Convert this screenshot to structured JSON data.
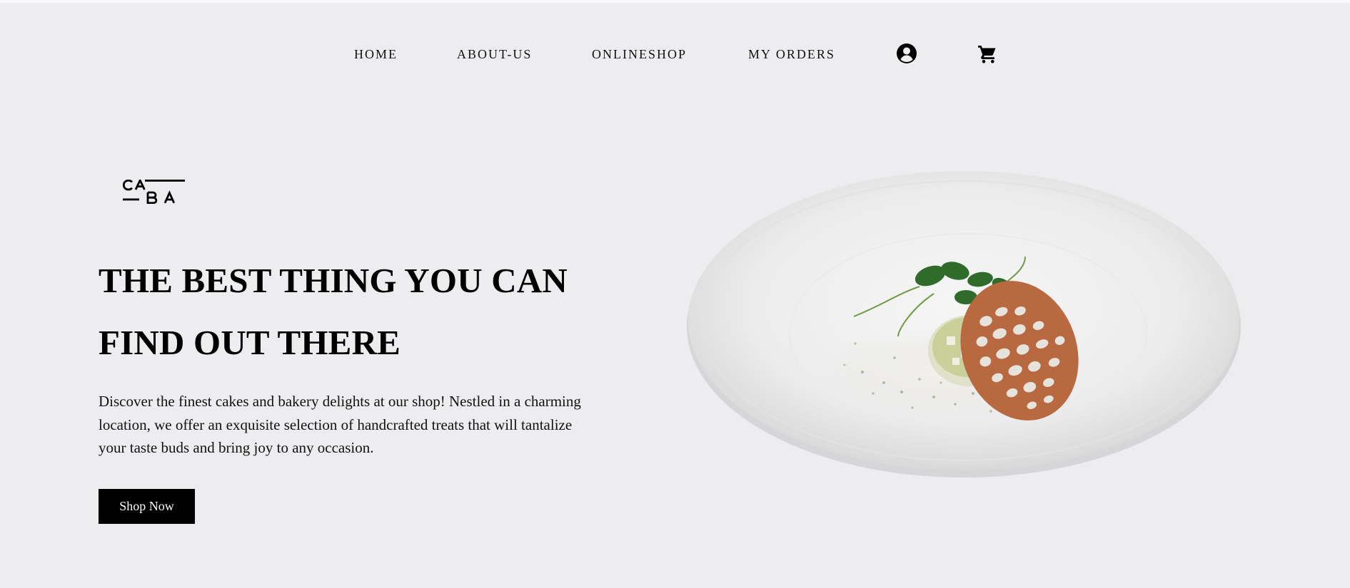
{
  "nav": {
    "items": [
      {
        "label": "HOME"
      },
      {
        "label": "ABOUT-US"
      },
      {
        "label": "ONLINESHOP"
      },
      {
        "label": "MY ORDERS"
      }
    ],
    "account_icon": "user-circle-icon",
    "cart_icon": "shopping-cart-icon"
  },
  "brand": {
    "logo_text": "CABA"
  },
  "hero": {
    "headline_line1": "THE BEST THING YOU CAN",
    "headline_line2": "FIND OUT THERE",
    "description": "Discover the finest cakes and bakery delights at our shop! Nestled in a charming location, we offer an exquisite selection of handcrafted treats that will tantalize your taste buds and bring joy to any occasion.",
    "cta_label": "Shop Now",
    "image_subject": "plated-dish-image"
  },
  "colors": {
    "background": "#ededf0",
    "text": "#000000",
    "button_bg": "#000000",
    "button_text": "#ffffff"
  }
}
